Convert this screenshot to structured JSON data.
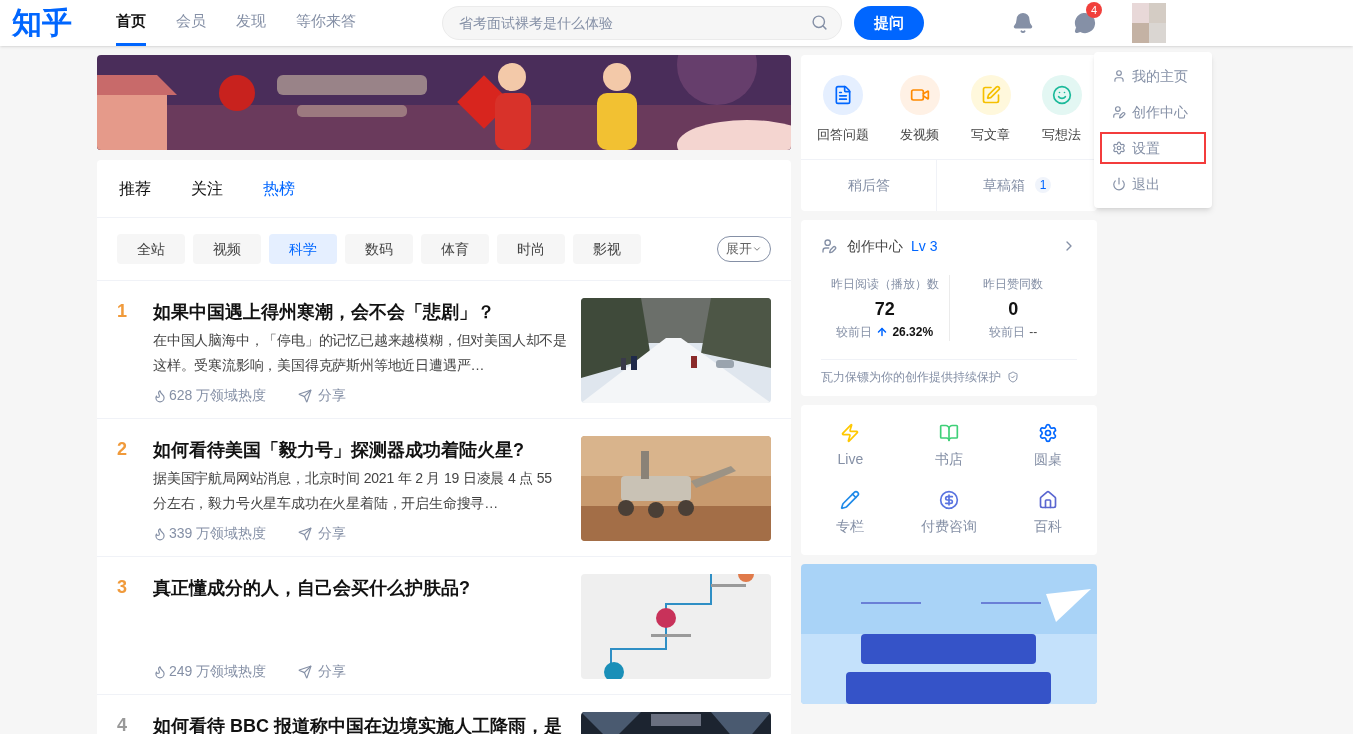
{
  "header": {
    "logo": "知乎",
    "nav": [
      {
        "label": "首页",
        "selected": true
      },
      {
        "label": "会员",
        "selected": false
      },
      {
        "label": "发现",
        "selected": false
      },
      {
        "label": "等你来答",
        "selected": false
      }
    ],
    "search": {
      "placeholder": "省考面试裸考是什么体验"
    },
    "ask_button": "提问",
    "message_badge": "4"
  },
  "feed_tabs": [
    {
      "label": "推荐",
      "selected": false
    },
    {
      "label": "关注",
      "selected": false
    },
    {
      "label": "热榜",
      "selected": true
    }
  ],
  "categories": [
    {
      "label": "全站",
      "selected": false
    },
    {
      "label": "视频",
      "selected": false
    },
    {
      "label": "科学",
      "selected": true
    },
    {
      "label": "数码",
      "selected": false
    },
    {
      "label": "体育",
      "selected": false
    },
    {
      "label": "时尚",
      "selected": false
    },
    {
      "label": "影视",
      "selected": false
    }
  ],
  "expand_button": "展开",
  "hot_list": [
    {
      "rank": "1",
      "title": "如果中国遇上得州寒潮，会不会「悲剧」？",
      "excerpt": "在中国人脑海中，「停电」的记忆已越来越模糊，但对美国人却不是这样。受寒流影响，美国得克萨斯州等地近日遭遇严…",
      "heat": "628 万领域热度",
      "share": "分享"
    },
    {
      "rank": "2",
      "title": "如何看待美国「毅力号」探测器成功着陆火星?",
      "excerpt": "据美国宇航局网站消息，北京时间 2021 年 2 月 19 日凌晨 4 点 55 分左右，毅力号火星车成功在火星着陆，开启生命搜寻…",
      "heat": "339 万领域热度",
      "share": "分享"
    },
    {
      "rank": "3",
      "title": "真正懂成分的人，自己会买什么护肤品?",
      "heat": "249 万领域热度",
      "share": "分享"
    },
    {
      "rank": "4",
      "title": "如何看待 BBC 报道称中国在边境实施人工降雨，是"
    }
  ],
  "create_card": {
    "actions": [
      "回答问题",
      "发视频",
      "写文章",
      "写想法"
    ],
    "later": "稍后答",
    "drafts": "草稿箱",
    "drafts_count": "1"
  },
  "creator_card": {
    "title": "创作中心",
    "level": "Lv 3",
    "stats": [
      {
        "kind": "rise",
        "label": "昨日阅读（播放）数",
        "value": "72",
        "compare_label": "较前日",
        "change": "26.32%"
      },
      {
        "kind": "flat",
        "label": "昨日赞同数",
        "value": "0",
        "compare_label": "较前日",
        "change": "--"
      }
    ],
    "footer": "瓦力保镖为你的创作提供持续保护"
  },
  "services": [
    "Live",
    "书店",
    "圆桌",
    "专栏",
    "付费咨询",
    "百科"
  ],
  "user_menu": [
    {
      "label": "我的主页",
      "selected": false
    },
    {
      "label": "创作中心",
      "selected": false
    },
    {
      "label": "设置",
      "selected": true
    },
    {
      "label": "退出",
      "selected": false
    }
  ]
}
